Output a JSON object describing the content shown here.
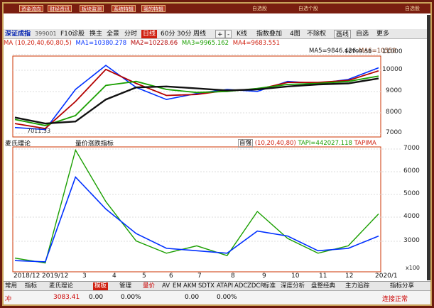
{
  "menu": {
    "buttons": [
      "资金流向",
      "财经资讯",
      "板块监测",
      "系统特辑",
      "我的特辑"
    ],
    "right_labels": [
      "自选股",
      "自选个股"
    ],
    "corner": "自选股"
  },
  "toolbar": {
    "symbol": "深证成指",
    "code": "399001",
    "items": [
      "F10",
      "诊股",
      "换主",
      "全景",
      "分时",
      "日线",
      "60分",
      "30分",
      "周线",
      "+",
      "-",
      "K线",
      "指数叠加",
      "4图",
      "不除权",
      "画线",
      "自选",
      "更多"
    ]
  },
  "ma": {
    "label": "MA",
    "params": "(10,20,40,60,80,5)",
    "ma1": "MA1=10380.278",
    "ma2": "MA2=10228.66",
    "ma3": "MA3=9965.162",
    "ma4": "MA4=9683.551",
    "ma5": "MA5=9846.426",
    "ma6": "MA6=10558",
    "high_label": "10799.58",
    "low_label": "7011.33",
    "colors": [
      "#e8001c",
      "#0030ff",
      "#b30000",
      "#1a9f00",
      "#111111",
      "#7a3a1a"
    ]
  },
  "price_axis": [
    "11000",
    "10000",
    "9000",
    "8000",
    "7000"
  ],
  "volume": {
    "title": "麦氏理论",
    "subtitle": "量价涨跌指标",
    "mode": "自强",
    "params": "(10,20,40,80)",
    "tapi": "TAPI=442027.118",
    "tapima": "TAPIMA",
    "axis": [
      "7000",
      "6000",
      "5000",
      "4000",
      "3000"
    ],
    "unit": "x100"
  },
  "x_axis": [
    "2018/12",
    "2019/12",
    "3",
    "4",
    "5",
    "6",
    "7",
    "8",
    "9",
    "10",
    "11",
    "12",
    "2020/1"
  ],
  "tabs": [
    "常用",
    "指标",
    "麦氏理论",
    "模板",
    "管理",
    "量价",
    "AV",
    "EM",
    "AKM",
    "SDTX",
    "ATAPI",
    "ADC",
    "ZDCR",
    "标准",
    "深度分析",
    "盘整经典",
    "主力追踪",
    "指标分享"
  ],
  "status": {
    "label": "冲",
    "index_value": "3083.41",
    "change": "0.00",
    "pct": "0.00%",
    "right_value": "0.00",
    "right_pct": "0.00%",
    "right_label": "连接正常"
  },
  "chart_data": [
    {
      "type": "line",
      "title": "深证成指 日线",
      "x": [
        "2018/12",
        "2019/12",
        "3",
        "4",
        "5",
        "6",
        "7",
        "8",
        "9",
        "10",
        "11",
        "12",
        "2020/1"
      ],
      "ylim": [
        7000,
        11000
      ],
      "series": [
        {
          "name": "MA1",
          "values": [
            7400,
            7300,
            9300,
            10500,
            9400,
            8800,
            9100,
            9300,
            9200,
            9700,
            9600,
            9800,
            10380
          ]
        },
        {
          "name": "MA2",
          "values": [
            7600,
            7350,
            8700,
            10300,
            9600,
            9000,
            9050,
            9250,
            9300,
            9650,
            9650,
            9750,
            10228
          ]
        },
        {
          "name": "MA3",
          "values": [
            7800,
            7500,
            8000,
            9500,
            9700,
            9300,
            9150,
            9200,
            9350,
            9550,
            9600,
            9700,
            9965
          ]
        },
        {
          "name": "MA5",
          "values": [
            7900,
            7600,
            7700,
            8800,
            9400,
            9450,
            9350,
            9250,
            9300,
            9450,
            9550,
            9600,
            9846
          ]
        }
      ]
    },
    {
      "type": "line",
      "title": "量价涨跌指标",
      "x": [
        "2018/12",
        "2019/12",
        "3",
        "4",
        "5",
        "6",
        "7",
        "8",
        "9",
        "10",
        "11",
        "12",
        "2020/1"
      ],
      "ylim": [
        2000,
        7000
      ],
      "series": [
        {
          "name": "TAPI",
          "values": [
            2500,
            2300,
            6900,
            4800,
            3200,
            2700,
            3000,
            2600,
            4400,
            3300,
            2700,
            3000,
            4300
          ]
        },
        {
          "name": "TAPIMA",
          "values": [
            2400,
            2350,
            5800,
            4500,
            3500,
            2900,
            2800,
            2700,
            3600,
            3400,
            2800,
            2900,
            3400
          ]
        }
      ]
    }
  ]
}
